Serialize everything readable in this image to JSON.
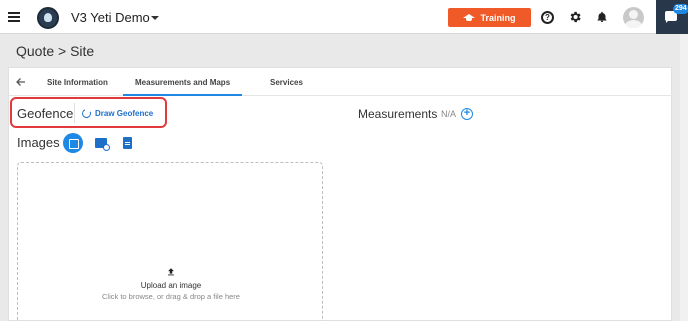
{
  "header": {
    "app_title": "V3 Yeti Demo",
    "training_label": "Training",
    "help_glyph": "?",
    "chat_badge": "294",
    "icons": [
      "menu-icon",
      "logo",
      "chevron-down-icon",
      "graduation-cap-icon",
      "help-icon",
      "gear-icon",
      "bell-icon",
      "avatar",
      "chat-icon"
    ],
    "colors": {
      "training_button": "#f05a28",
      "chat_panel": "#29374a",
      "accent": "#1e88e5"
    }
  },
  "breadcrumb": "Quote > Site",
  "tabs": [
    {
      "label": "Site Information",
      "active": false
    },
    {
      "label": "Measurements and Maps",
      "active": true
    },
    {
      "label": "Services",
      "active": false
    }
  ],
  "geofence": {
    "label": "Geofence",
    "action_label": "Draw Geofence",
    "highlight_color": "#e23a3a"
  },
  "measurements": {
    "label": "Measurements",
    "value": "N/A",
    "add_glyph": "+"
  },
  "images": {
    "label": "Images",
    "upload_title": "Upload an image",
    "upload_hint": "Click to browse, or drag & drop a file here"
  }
}
